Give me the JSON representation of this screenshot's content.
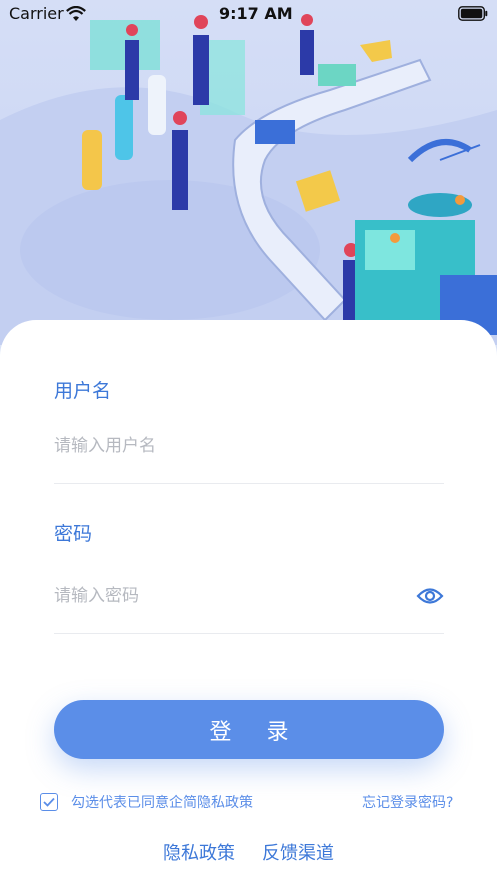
{
  "status_bar": {
    "carrier": "Carrier",
    "time": "9:17 AM"
  },
  "form": {
    "username_label": "用户名",
    "username_placeholder": "请输入用户名",
    "password_label": "密码",
    "password_placeholder": "请输入密码",
    "login_button": "登 录"
  },
  "agreement": {
    "checked": true,
    "text": "勾选代表已同意企简隐私政策"
  },
  "forgot_password": "忘记登录密码?",
  "footer_links": [
    "隐私政策",
    "反馈渠道"
  ],
  "colors": {
    "accent": "#5b8ee8",
    "label": "#3d78d8",
    "hero_bg": "#d5def6"
  },
  "icons": [
    "wifi-icon",
    "battery-icon",
    "eye-icon",
    "checkmark-icon"
  ]
}
